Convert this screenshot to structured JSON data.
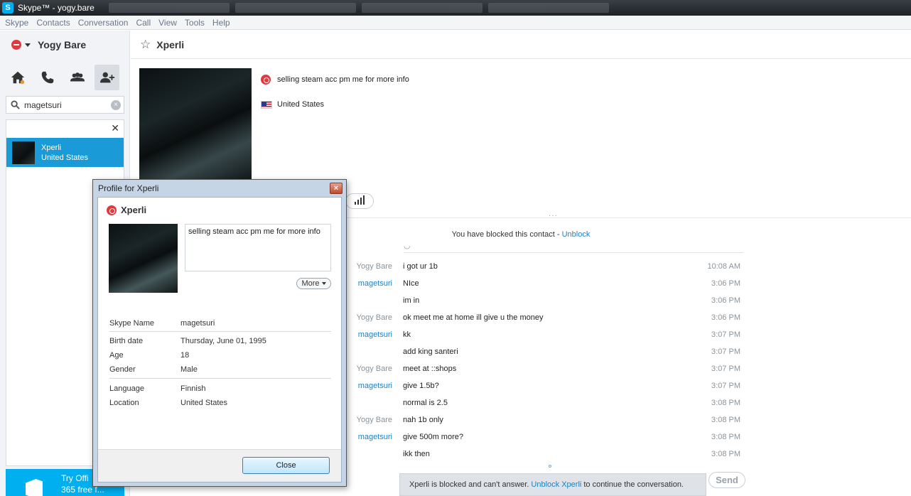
{
  "window": {
    "app_icon_letter": "S",
    "title": "Skype™ - yogy.bare"
  },
  "menu": [
    "Skype",
    "Contacts",
    "Conversation",
    "Call",
    "View",
    "Tools",
    "Help"
  ],
  "sidebar": {
    "profile_name": "Yogy Bare",
    "search": {
      "value": "magetsuri",
      "placeholder": ""
    },
    "results": [
      {
        "name": "Xperli",
        "location": "United States"
      }
    ],
    "promo": {
      "line1": "Try Offi",
      "line2": "365 free f..."
    }
  },
  "conversation": {
    "title": "Xperli",
    "mood": "selling steam acc pm me for more info",
    "country": "United States",
    "blocked_notice": "You have blocked this contact - ",
    "unblock_link": "Unblock",
    "messages": [
      {
        "sender": "Yogy Bare",
        "remote": false,
        "text": "i got ur 1b",
        "time": "10:08 AM"
      },
      {
        "sender": "magetsuri",
        "remote": true,
        "text": "NIce",
        "time": "3:06 PM"
      },
      {
        "sender": "",
        "remote": true,
        "text": "im in",
        "time": "3:06 PM"
      },
      {
        "sender": "Yogy Bare",
        "remote": false,
        "text": "ok meet me at home ill give u the money",
        "time": "3:06 PM"
      },
      {
        "sender": "magetsuri",
        "remote": true,
        "text": "kk",
        "time": "3:07 PM"
      },
      {
        "sender": "",
        "remote": true,
        "text": "add king santeri",
        "time": "3:07 PM"
      },
      {
        "sender": "Yogy Bare",
        "remote": false,
        "text": "meet at ::shops",
        "time": "3:07 PM"
      },
      {
        "sender": "magetsuri",
        "remote": true,
        "text": "give 1.5b?",
        "time": "3:07 PM"
      },
      {
        "sender": "",
        "remote": true,
        "text": "normal is 2.5",
        "time": "3:08 PM"
      },
      {
        "sender": "Yogy Bare",
        "remote": false,
        "text": "nah 1b only",
        "time": "3:08 PM"
      },
      {
        "sender": "magetsuri",
        "remote": true,
        "text": "give 500m more?",
        "time": "3:08 PM"
      },
      {
        "sender": "",
        "remote": true,
        "text": "ikk then",
        "time": "3:08 PM"
      }
    ],
    "compose": {
      "prefix": "Xperli is blocked and can't answer.",
      "link": "Unblock Xperli",
      "suffix": "to continue the conversation."
    },
    "send_label": "Send"
  },
  "dialog": {
    "title": "Profile for Xperli",
    "close_x": "×",
    "name": "Xperli",
    "mood": "selling steam acc pm me for more info",
    "more_label": "More",
    "details": [
      {
        "label": "Skype Name",
        "value": "magetsuri"
      },
      {
        "label": "Birth date",
        "value": "Thursday, June 01, 1995"
      },
      {
        "label": "Age",
        "value": "18"
      },
      {
        "label": "Gender",
        "value": "Male"
      },
      {
        "label": "Language",
        "value": "Finnish"
      },
      {
        "label": "Location",
        "value": "United States"
      }
    ],
    "close_label": "Close"
  },
  "colors": {
    "accent": "#1a9ad6",
    "link": "#1a82c4",
    "status_dnd": "#e0393e",
    "promo_bg": "#00aff0"
  }
}
